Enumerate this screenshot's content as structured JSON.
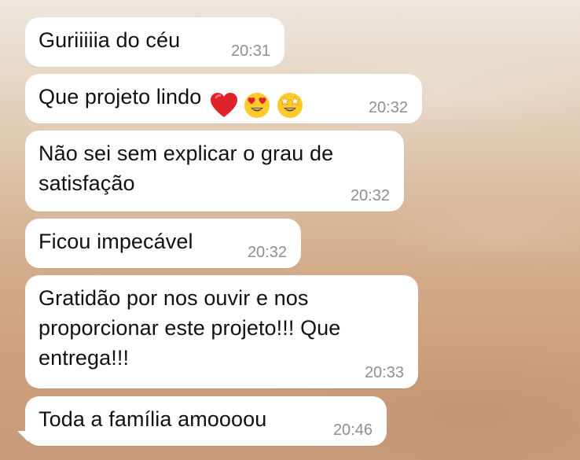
{
  "chat": {
    "messages": [
      {
        "text": "Guriiiiia do céu",
        "time": "20:31"
      },
      {
        "text": "Que projeto lindo",
        "time": "20:32",
        "emojis": [
          "red-heart-icon",
          "heart-eyes-face-icon",
          "star-struck-face-icon"
        ]
      },
      {
        "text": "Não sei sem explicar o grau de satisfação",
        "time": "20:32"
      },
      {
        "text": "Ficou impecável",
        "time": "20:32"
      },
      {
        "text": "Gratidão por nos ouvir e nos proporcionar este projeto!!! Que entrega!!!",
        "time": "20:33"
      },
      {
        "text": "Toda a família amoooou",
        "time": "20:46"
      }
    ]
  },
  "colors": {
    "bubble_bg": "#ffffff",
    "text": "#111111",
    "timestamp": "#8e8e93",
    "heart": "#e0232b",
    "emoji_face": "#ffca28"
  }
}
